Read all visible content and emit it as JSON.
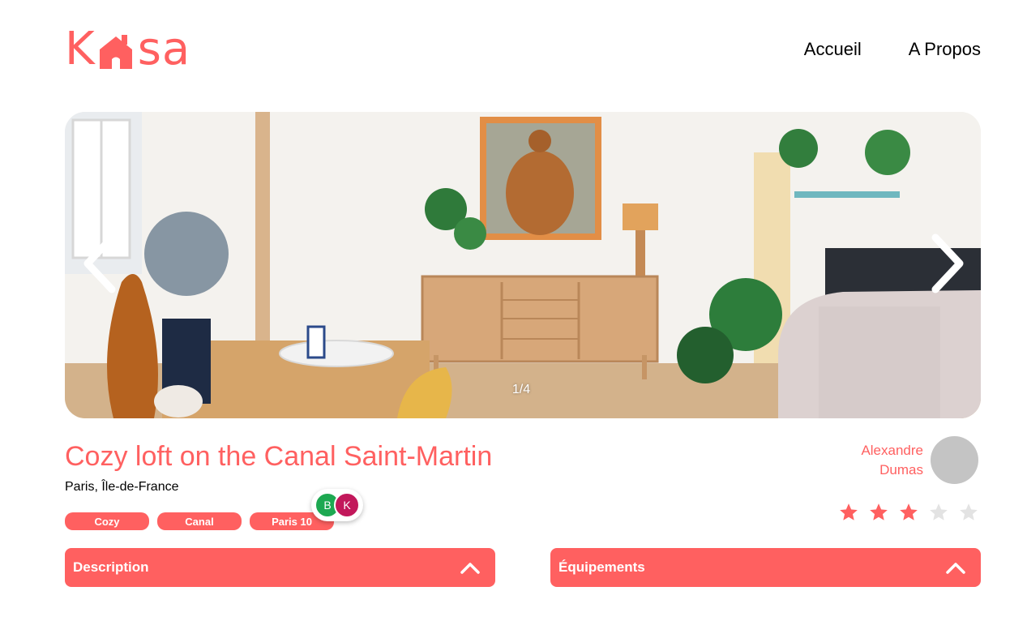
{
  "header": {
    "logo": {
      "part1": "K",
      "part2": "sa",
      "icon": "house-icon"
    },
    "nav": [
      {
        "label": "Accueil"
      },
      {
        "label": "A Propos"
      }
    ]
  },
  "carousel": {
    "counter": "1/4",
    "prev_icon": "chevron-left-icon",
    "next_icon": "chevron-right-icon"
  },
  "listing": {
    "title": "Cozy loft on the Canal Saint-Martin",
    "location": "Paris, Île-de-France",
    "tags": [
      "Cozy",
      "Canal",
      "Paris 10"
    ]
  },
  "collab_avatars": [
    {
      "initial": "B",
      "color": "#1DA851"
    },
    {
      "initial": "K",
      "color": "#C2185B"
    }
  ],
  "host": {
    "first_name": "Alexandre",
    "last_name": "Dumas",
    "rating": 3,
    "max_rating": 5
  },
  "colors": {
    "accent": "#FF6060",
    "star_empty": "#E3E3E3",
    "avatar_placeholder": "#C4C4C4"
  },
  "collapses": [
    {
      "label": "Description",
      "icon": "chevron-up-icon"
    },
    {
      "label": "Équipements",
      "icon": "chevron-up-icon"
    }
  ]
}
